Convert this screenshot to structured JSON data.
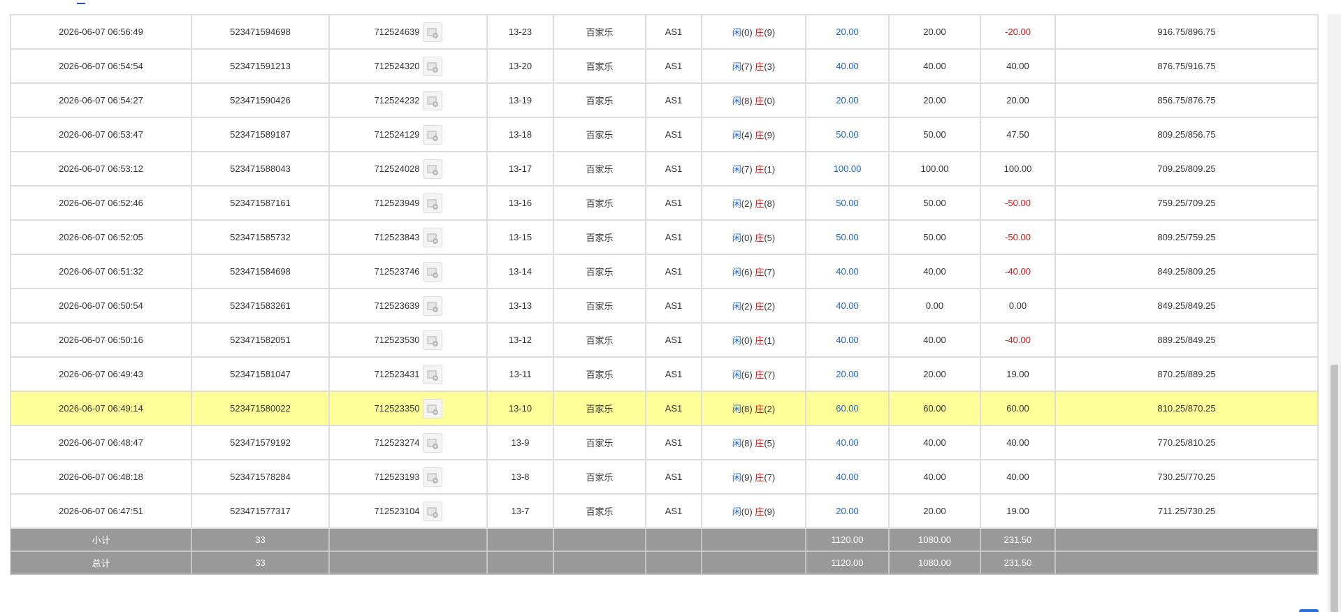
{
  "result_labels": {
    "player": "闲",
    "banker": "庄"
  },
  "rows": [
    {
      "time": "2026-06-07 06:56:49",
      "bet_id": "523471594698",
      "room": "712524639",
      "round": "13-23",
      "game": "百家乐",
      "table": "AS1",
      "player": "(0)",
      "banker": "(9)",
      "bet": "20.00",
      "valid": "20.00",
      "win": "-20.00",
      "win_color": "red",
      "balance": "916.75/896.75",
      "highlight": false
    },
    {
      "time": "2026-06-07 06:54:54",
      "bet_id": "523471591213",
      "room": "712524320",
      "round": "13-20",
      "game": "百家乐",
      "table": "AS1",
      "player": "(7)",
      "banker": "(3)",
      "bet": "40.00",
      "valid": "40.00",
      "win": "40.00",
      "win_color": "normal",
      "balance": "876.75/916.75",
      "highlight": false
    },
    {
      "time": "2026-06-07 06:54:27",
      "bet_id": "523471590426",
      "room": "712524232",
      "round": "13-19",
      "game": "百家乐",
      "table": "AS1",
      "player": "(8)",
      "banker": "(0)",
      "bet": "20.00",
      "valid": "20.00",
      "win": "20.00",
      "win_color": "normal",
      "balance": "856.75/876.75",
      "highlight": false
    },
    {
      "time": "2026-06-07 06:53:47",
      "bet_id": "523471589187",
      "room": "712524129",
      "round": "13-18",
      "game": "百家乐",
      "table": "AS1",
      "player": "(4)",
      "banker": "(9)",
      "bet": "50.00",
      "valid": "50.00",
      "win": "47.50",
      "win_color": "normal",
      "balance": "809.25/856.75",
      "highlight": false
    },
    {
      "time": "2026-06-07 06:53:12",
      "bet_id": "523471588043",
      "room": "712524028",
      "round": "13-17",
      "game": "百家乐",
      "table": "AS1",
      "player": "(7)",
      "banker": "(1)",
      "bet": "100.00",
      "valid": "100.00",
      "win": "100.00",
      "win_color": "normal",
      "balance": "709.25/809.25",
      "highlight": false
    },
    {
      "time": "2026-06-07 06:52:46",
      "bet_id": "523471587161",
      "room": "712523949",
      "round": "13-16",
      "game": "百家乐",
      "table": "AS1",
      "player": "(2)",
      "banker": "(8)",
      "bet": "50.00",
      "valid": "50.00",
      "win": "-50.00",
      "win_color": "red",
      "balance": "759.25/709.25",
      "highlight": false
    },
    {
      "time": "2026-06-07 06:52:05",
      "bet_id": "523471585732",
      "room": "712523843",
      "round": "13-15",
      "game": "百家乐",
      "table": "AS1",
      "player": "(0)",
      "banker": "(5)",
      "bet": "50.00",
      "valid": "50.00",
      "win": "-50.00",
      "win_color": "red",
      "balance": "809.25/759.25",
      "highlight": false
    },
    {
      "time": "2026-06-07 06:51:32",
      "bet_id": "523471584698",
      "room": "712523746",
      "round": "13-14",
      "game": "百家乐",
      "table": "AS1",
      "player": "(6)",
      "banker": "(7)",
      "bet": "40.00",
      "valid": "40.00",
      "win": "-40.00",
      "win_color": "red",
      "balance": "849.25/809.25",
      "highlight": false
    },
    {
      "time": "2026-06-07 06:50:54",
      "bet_id": "523471583261",
      "room": "712523639",
      "round": "13-13",
      "game": "百家乐",
      "table": "AS1",
      "player": "(2)",
      "banker": "(2)",
      "bet": "40.00",
      "valid": "0.00",
      "win": "0.00",
      "win_color": "normal",
      "balance": "849.25/849.25",
      "highlight": false
    },
    {
      "time": "2026-06-07 06:50:16",
      "bet_id": "523471582051",
      "room": "712523530",
      "round": "13-12",
      "game": "百家乐",
      "table": "AS1",
      "player": "(0)",
      "banker": "(1)",
      "bet": "40.00",
      "valid": "40.00",
      "win": "-40.00",
      "win_color": "red",
      "balance": "889.25/849.25",
      "highlight": false
    },
    {
      "time": "2026-06-07 06:49:43",
      "bet_id": "523471581047",
      "room": "712523431",
      "round": "13-11",
      "game": "百家乐",
      "table": "AS1",
      "player": "(6)",
      "banker": "(7)",
      "bet": "20.00",
      "valid": "20.00",
      "win": "19.00",
      "win_color": "normal",
      "balance": "870.25/889.25",
      "highlight": false
    },
    {
      "time": "2026-06-07 06:49:14",
      "bet_id": "523471580022",
      "room": "712523350",
      "round": "13-10",
      "game": "百家乐",
      "table": "AS1",
      "player": "(8)",
      "banker": "(2)",
      "bet": "60.00",
      "valid": "60.00",
      "win": "60.00",
      "win_color": "normal",
      "balance": "810.25/870.25",
      "highlight": true
    },
    {
      "time": "2026-06-07 06:48:47",
      "bet_id": "523471579192",
      "room": "712523274",
      "round": "13-9",
      "game": "百家乐",
      "table": "AS1",
      "player": "(8)",
      "banker": "(5)",
      "bet": "40.00",
      "valid": "40.00",
      "win": "40.00",
      "win_color": "normal",
      "balance": "770.25/810.25",
      "highlight": false
    },
    {
      "time": "2026-06-07 06:48:18",
      "bet_id": "523471578284",
      "room": "712523193",
      "round": "13-8",
      "game": "百家乐",
      "table": "AS1",
      "player": "(9)",
      "banker": "(7)",
      "bet": "40.00",
      "valid": "40.00",
      "win": "40.00",
      "win_color": "normal",
      "balance": "730.25/770.25",
      "highlight": false
    },
    {
      "time": "2026-06-07 06:47:51",
      "bet_id": "523471577317",
      "room": "712523104",
      "round": "13-7",
      "game": "百家乐",
      "table": "AS1",
      "player": "(0)",
      "banker": "(9)",
      "bet": "20.00",
      "valid": "20.00",
      "win": "19.00",
      "win_color": "normal",
      "balance": "711.25/730.25",
      "highlight": false
    }
  ],
  "subtotal": {
    "label": "小计",
    "count": "33",
    "bet": "1120.00",
    "valid": "1080.00",
    "win": "231.50"
  },
  "total": {
    "label": "总计",
    "count": "33",
    "bet": "1120.00",
    "valid": "1080.00",
    "win": "231.50"
  },
  "colors": {
    "highlight_row": "#ffff99",
    "summary_row": "#999999",
    "link_blue": "#1a64d6",
    "loss_red": "#e01010"
  },
  "icons": {
    "video": "video-replay-icon",
    "back": "back-arrow-icon"
  }
}
